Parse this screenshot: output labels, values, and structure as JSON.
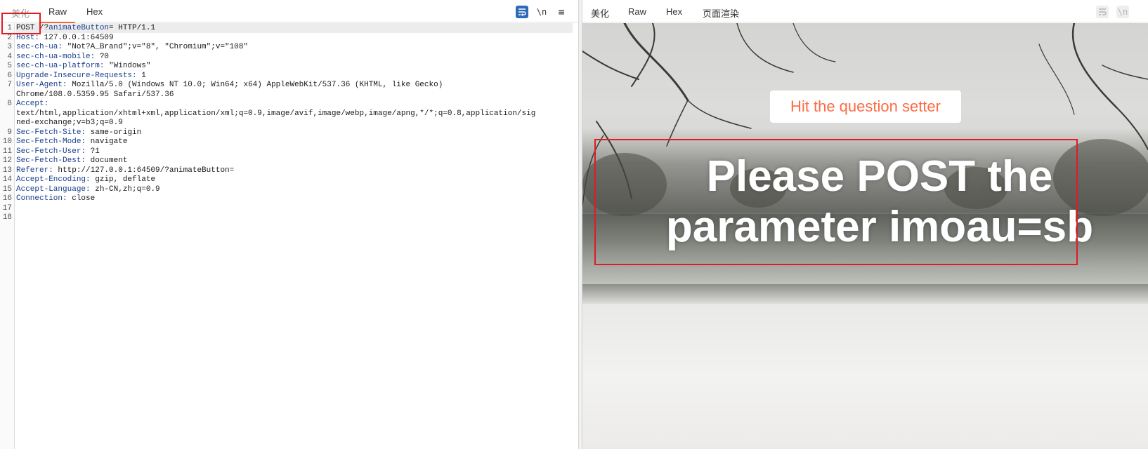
{
  "request_pane": {
    "tabs": [
      "美化",
      "Raw",
      "Hex"
    ],
    "active_tab": "Raw",
    "tools": {
      "wrap_icon": "wrap-lines-icon",
      "newline_label": "\\n",
      "menu_label": "≡"
    },
    "lines": [
      {
        "n": "1",
        "name": "",
        "value": "POST /?animateButton= HTTP/1.1",
        "first_token": "POST",
        "rest": " /?",
        "param": "animateButton",
        "tail": "= HTTP/1.1"
      },
      {
        "n": "2",
        "name": "Host:",
        "value": " 127.0.0.1:64509"
      },
      {
        "n": "3",
        "name": "sec-ch-ua:",
        "value": " \"Not?A_Brand\";v=\"8\", \"Chromium\";v=\"108\""
      },
      {
        "n": "4",
        "name": "sec-ch-ua-mobile:",
        "value": " ?0"
      },
      {
        "n": "5",
        "name": "sec-ch-ua-platform:",
        "value": " \"Windows\""
      },
      {
        "n": "6",
        "name": "Upgrade-Insecure-Requests:",
        "value": " 1"
      },
      {
        "n": "7",
        "name": "User-Agent:",
        "value": " Mozilla/5.0 (Windows NT 10.0; Win64; x64) AppleWebKit/537.36 (KHTML, like Gecko)"
      },
      {
        "n": "",
        "name": "",
        "value": "Chrome/108.0.5359.95 Safari/537.36"
      },
      {
        "n": "8",
        "name": "Accept:",
        "value": ""
      },
      {
        "n": "",
        "name": "",
        "value": "text/html,application/xhtml+xml,application/xml;q=0.9,image/avif,image/webp,image/apng,*/*;q=0.8,application/sig"
      },
      {
        "n": "",
        "name": "",
        "value": "ned-exchange;v=b3;q=0.9"
      },
      {
        "n": "9",
        "name": "Sec-Fetch-Site:",
        "value": " same-origin"
      },
      {
        "n": "10",
        "name": "Sec-Fetch-Mode:",
        "value": " navigate"
      },
      {
        "n": "11",
        "name": "Sec-Fetch-User:",
        "value": " ?1"
      },
      {
        "n": "12",
        "name": "Sec-Fetch-Dest:",
        "value": " document"
      },
      {
        "n": "13",
        "name": "Referer:",
        "value": " http://127.0.0.1:64509/?animateButton="
      },
      {
        "n": "14",
        "name": "Accept-Encoding:",
        "value": " gzip, deflate"
      },
      {
        "n": "15",
        "name": "Accept-Language:",
        "value": " zh-CN,zh;q=0.9"
      },
      {
        "n": "16",
        "name": "Connection:",
        "value": " close"
      },
      {
        "n": "17",
        "name": "",
        "value": ""
      },
      {
        "n": "18",
        "name": "",
        "value": ""
      }
    ]
  },
  "response_pane": {
    "tabs": [
      "美化",
      "Raw",
      "Hex",
      "页面渲染"
    ],
    "active_tab": "页面渲染",
    "tools": {
      "wrap_icon": "wrap-lines-icon",
      "newline_label": "\\n"
    },
    "page": {
      "button_label": "Hit the question setter",
      "headline_line1": "Please POST the",
      "headline_line2": "parameter imoau=sb"
    }
  },
  "colors": {
    "accent_tab_underline": "#ff6633",
    "header_name": "#1a3f8c",
    "annotation_red": "#e01b24",
    "button_text": "#ff6b45"
  }
}
